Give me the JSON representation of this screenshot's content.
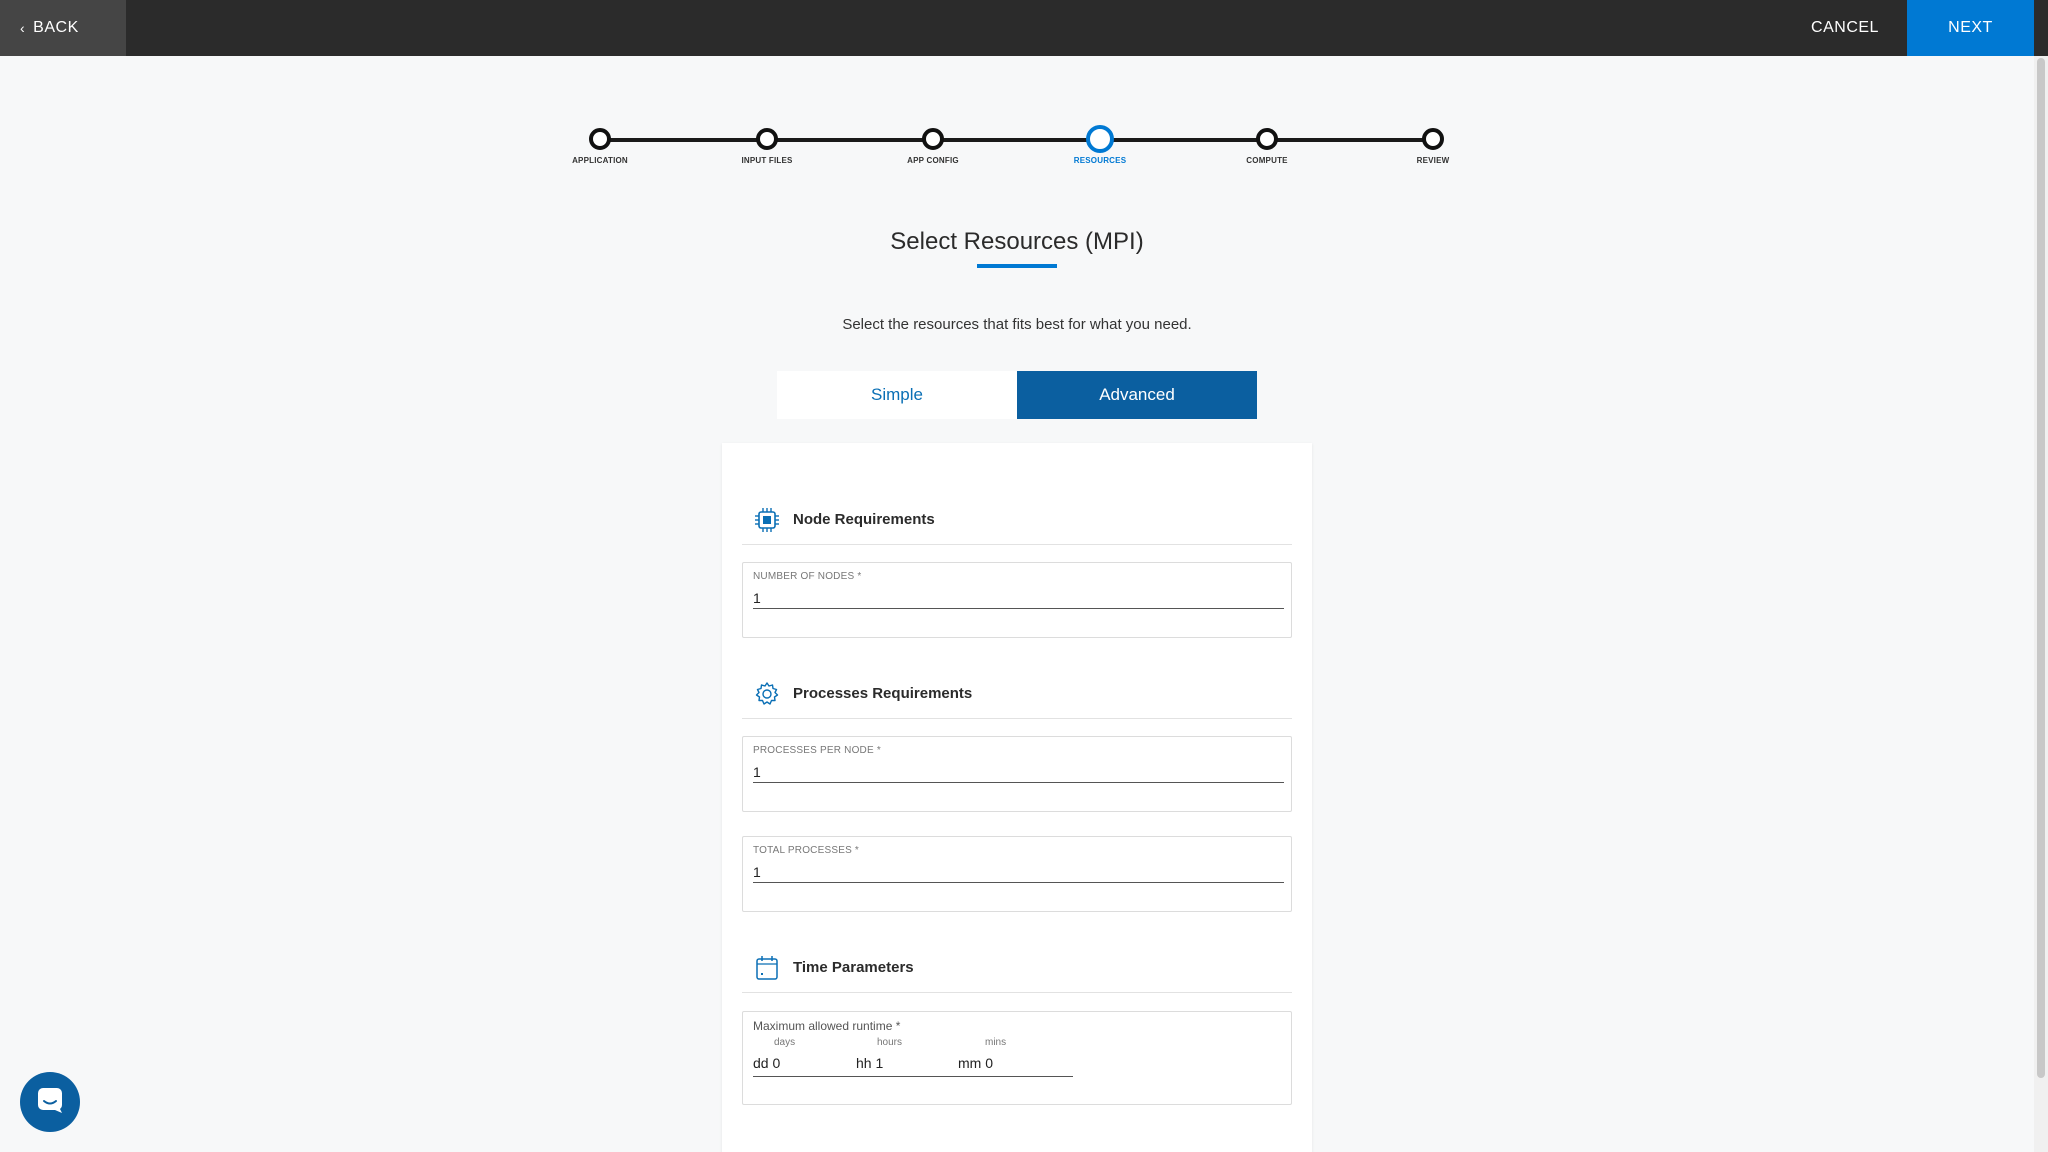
{
  "topbar": {
    "back_label": "BACK",
    "cancel_label": "CANCEL",
    "next_label": "NEXT"
  },
  "stepper": {
    "steps": [
      "APPLICATION",
      "INPUT FILES",
      "APP CONFIG",
      "RESOURCES",
      "COMPUTE",
      "REVIEW"
    ],
    "active_step": "RESOURCES"
  },
  "page": {
    "title": "Select Resources (MPI)",
    "subtitle": "Select the resources that fits best for what you need."
  },
  "mode_toggle": {
    "simple_label": "Simple",
    "advanced_label": "Advanced",
    "selected": "Advanced"
  },
  "node_requirements": {
    "title": "Node Requirements",
    "icon": "cpu-chip-icon",
    "nodes_label": "NUMBER OF NODES *",
    "nodes_value": "1"
  },
  "process_requirements": {
    "title": "Processes Requirements",
    "icon": "gear-icon",
    "per_node_label": "PROCESSES PER NODE *",
    "per_node_value": "1",
    "total_label": "TOTAL PROCESSES *",
    "total_value": "1"
  },
  "time_parameters": {
    "title": "Time Parameters",
    "icon": "calendar-icon",
    "runtime_label": "Maximum allowed runtime *",
    "days_unit": "days",
    "hours_unit": "hours",
    "mins_unit": "mins",
    "days_prefix": "dd",
    "days_value": "0",
    "hours_prefix": "hh",
    "hours_value": "1",
    "mins_prefix": "mm",
    "mins_value": "0"
  },
  "colors": {
    "accent": "#0079d3",
    "toggle_active": "#0b5fa0",
    "topbar": "#2b2b2b"
  }
}
